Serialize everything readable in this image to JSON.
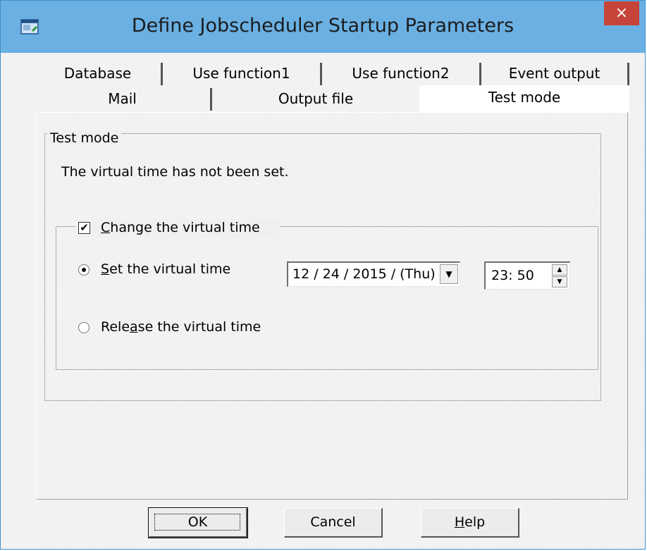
{
  "window": {
    "title": "Define Jobscheduler Startup Parameters",
    "icon": "app-window-icon",
    "close_label": "×"
  },
  "tabs": {
    "row1": [
      {
        "label": "Database"
      },
      {
        "label": "Use function1"
      },
      {
        "label": "Use function2"
      },
      {
        "label": "Event output"
      }
    ],
    "row2": [
      {
        "label": "Mail"
      },
      {
        "label": "Output file"
      },
      {
        "label": "Test mode",
        "selected": true
      }
    ]
  },
  "test_mode": {
    "group_label": "Test mode",
    "status_text": "The virtual time has not been set.",
    "change_checkbox": {
      "label_pre": "",
      "label_underlined": "C",
      "label_post": "hange the virtual time",
      "checked": true
    },
    "set_radio": {
      "label_pre": "",
      "label_underlined": "S",
      "label_post": "et the virtual time",
      "selected": true
    },
    "release_radio": {
      "label_pre": "Rele",
      "label_underlined": "a",
      "label_post": "se the virtual time",
      "selected": false
    },
    "date_value": "12 / 24 / 2015 / (Thu)",
    "time_value": "23: 50"
  },
  "buttons": {
    "ok": "OK",
    "cancel": "Cancel",
    "help_underlined": "H",
    "help_rest": "elp"
  },
  "colors": {
    "titlebar": "#6ab0e3",
    "close_button": "#c7443a",
    "window_bg": "#f0f0f0"
  }
}
